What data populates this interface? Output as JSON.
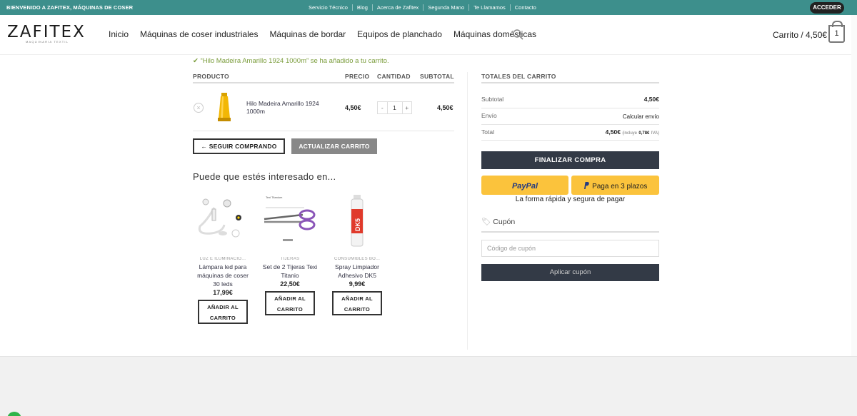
{
  "topbar": {
    "welcome": "BIENVENIDO A ZAFITEX, MÁQUINAS DE COSER",
    "links": [
      "Servicio Técnico",
      "Blog",
      "Acerca de Zafitex",
      "Segunda Mano",
      "Te Llamamos",
      "Contacto"
    ],
    "login_label": "ACCEDER"
  },
  "header": {
    "logo_text": "ZAFITEX",
    "logo_tagline": "MAQUINARIA TEXTIL",
    "nav": [
      "Inicio",
      "Máquinas de coser industriales",
      "Máquinas de bordar",
      "Equipos de planchado",
      "Máquinas domésticas"
    ],
    "search_icon": "search-icon",
    "cart_label": "Carrito / 4,50€",
    "cart_count": "1"
  },
  "notice": "“Hilo Madeira Amarillo 1924 1000m” se ha añadido a tu carrito.",
  "cart_table": {
    "headers": [
      "PRODUCTO",
      "PRECIO",
      "CANTIDAD",
      "SUBTOTAL"
    ],
    "items": [
      {
        "name": "Hilo Madeira Amarillo 1924 1000m",
        "price": "4,50€",
        "quantity": "1",
        "subtotal": "4,50€",
        "minus": "-",
        "plus": "+",
        "remove": "×"
      }
    ],
    "continue_label": "← SEGUIR COMPRANDO",
    "update_label": "ACTUALIZAR CARRITO"
  },
  "related": {
    "title": "Puede que estés interesado en...",
    "products": [
      {
        "category": "LUZ E ILUMINACIÓ...",
        "name": "Lámpara led para máquinas de coser 30 leds",
        "price": "17,99€",
        "button": "AÑADIR AL CARRITO"
      },
      {
        "category": "TIJERAS",
        "name": "Set de 2 Tijeras Texi Titanio",
        "price": "22,50€",
        "button": "AÑADIR AL CARRITO"
      },
      {
        "category": "CONSUMIBLES BO...",
        "name": "Spray Limpiador Adhesivo DK5",
        "price": "9,99€",
        "button": "AÑADIR AL CARRITO"
      }
    ]
  },
  "totals": {
    "title": "TOTALES DEL CARRITO",
    "subtotal_label": "Subtotal",
    "subtotal_value": "4,50€",
    "shipping_label": "Envío",
    "shipping_value": "Calcular envío",
    "total_label": "Total",
    "total_value": "4,50€",
    "total_tax_prefix": "(incluye",
    "total_tax_amount": "0,78€",
    "total_tax_suffix": "IVA)",
    "checkout_label": "FINALIZAR COMPRA",
    "paypal_label": "PayPal",
    "paypal_installments": "Paga en 3 plazos",
    "paypal_tagline": "La forma rápida y segura de pagar"
  },
  "coupon": {
    "title": "Cupón",
    "placeholder": "Código de cupón",
    "apply_label": "Aplicar cupón"
  },
  "colors": {
    "topbar": "#3d8f8c",
    "notice": "#7a9c3b",
    "dark_button": "#333a46",
    "paypal": "#fbc33c"
  }
}
